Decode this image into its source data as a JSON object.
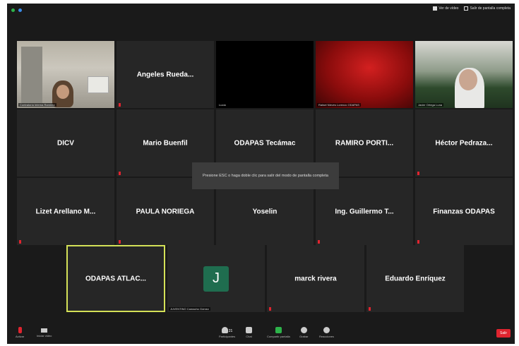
{
  "topbar": {
    "view_button": "Ver de vídeo",
    "exit_fullscreen": "Salir de pantalla completa"
  },
  "grid": {
    "row1": [
      {
        "tag": "Contraloría Interna Ramírez"
      },
      {
        "name": "Angeles Rueda..."
      },
      {
        "tag": "Lucía"
      },
      {
        "tag": "Rafael Nieves Lorenzo ODAPAS"
      },
      {
        "tag": "Javier Ortega Luna"
      }
    ],
    "row2": [
      {
        "name": "DICV"
      },
      {
        "name": "Mario Buenfil"
      },
      {
        "name": "ODAPAS Tecámac"
      },
      {
        "name": "RAMIRO PORTI..."
      },
      {
        "name": "Héctor Pedraza..."
      }
    ],
    "row3": [
      {
        "name": "Lizet Arellano M..."
      },
      {
        "name": "PAULA NORIEGA"
      },
      {
        "name": "Yoselin"
      },
      {
        "name": "Ing. Guillermo T..."
      },
      {
        "name": "Finanzas ODAPAS"
      }
    ],
    "row4": [
      {
        "name": "ODAPAS ATLAC..."
      },
      {
        "avatar": "J",
        "tag": "JUVENTINO Camacho Gómez"
      },
      {
        "name": "marck rivera"
      },
      {
        "name": "Eduardo Enríquez"
      }
    ]
  },
  "toast": "Presione ESC o haga doble clic para salir del modo de pantalla completa",
  "bottombar": {
    "mute": "Activar",
    "video": "Iniciar video",
    "participants_count": "21",
    "participants": "Participantes",
    "chat": "Chat",
    "share": "Compartir pantalla",
    "record": "Grabar",
    "reactions": "Reacciones",
    "end": "Salir"
  },
  "colors": {
    "background": "#1a1a1a",
    "tile": "#262626",
    "active_outline": "#d4e157",
    "share_green": "#2db34a",
    "end_red": "#e0242f"
  }
}
